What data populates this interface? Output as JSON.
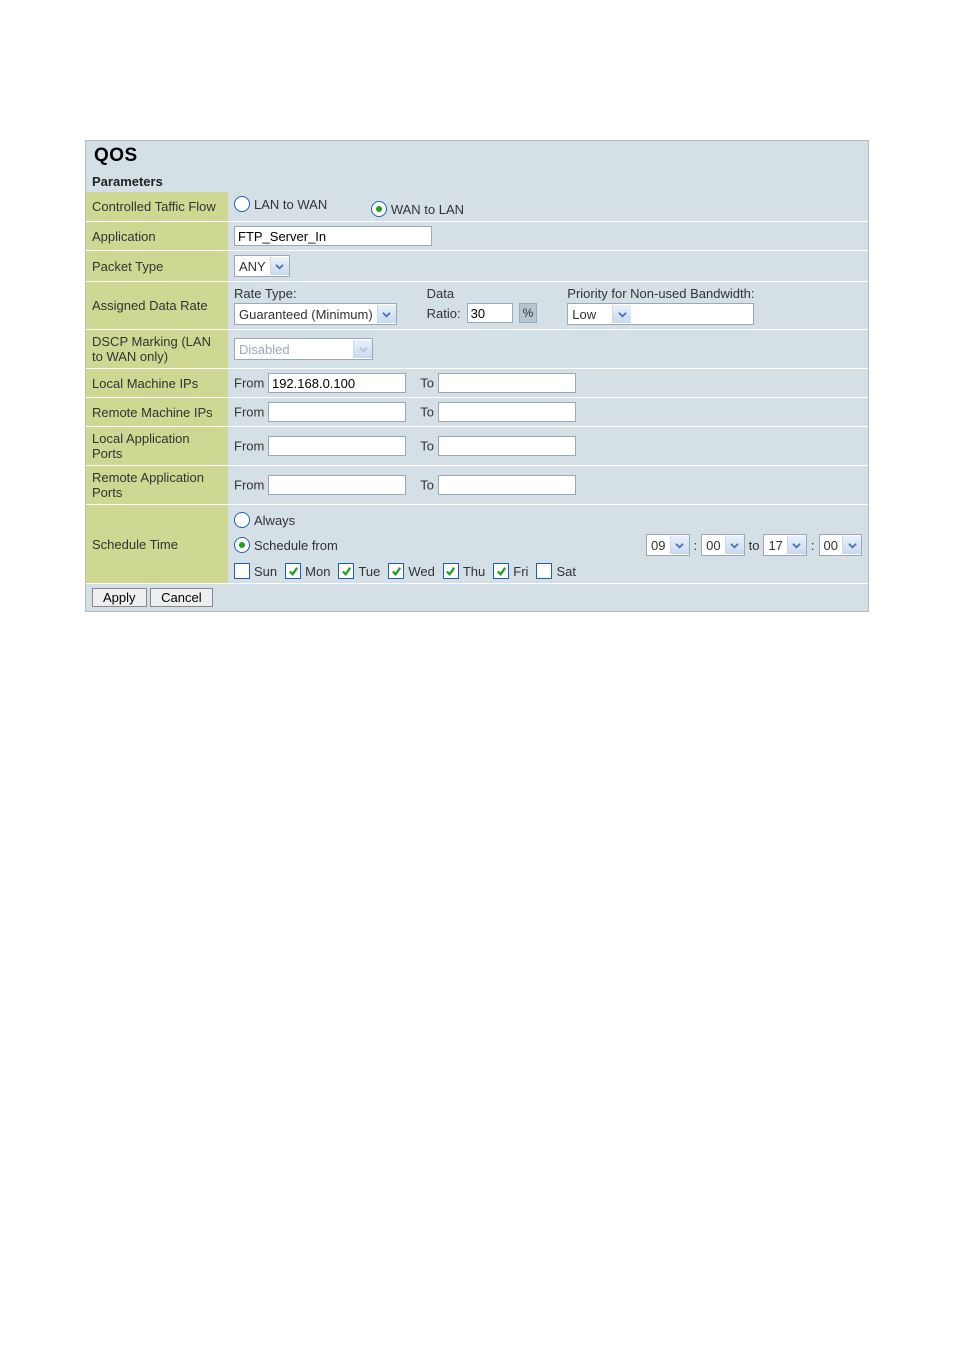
{
  "title": "QOS",
  "section": "Parameters",
  "rows": {
    "trafficFlow": {
      "label": "Controlled Taffic Flow",
      "opt1": "LAN to WAN",
      "opt2": "WAN to LAN",
      "selected": "wan_to_lan"
    },
    "application": {
      "label": "Application",
      "value": "FTP_Server_In"
    },
    "packetType": {
      "label": "Packet Type",
      "value": "ANY"
    },
    "assignedRate": {
      "label": "Assigned Data Rate",
      "rateTypeLabel": "Rate Type:",
      "rateTypeValue": "Guaranteed (Minimum)",
      "dataRatioLabel1": "Data",
      "dataRatioLabel2": "Ratio:",
      "dataRatioValue": "30",
      "dataRatioUnit": "%",
      "priorityLabel": "Priority for Non-used Bandwidth:",
      "priorityValue": "Low"
    },
    "dscp": {
      "label": "DSCP Marking (LAN to WAN only)",
      "value": "Disabled"
    },
    "localIPs": {
      "label": "Local Machine IPs",
      "fromLabel": "From",
      "fromValue": "192.168.0.100",
      "toLabel": "To",
      "toValue": ""
    },
    "remoteIPs": {
      "label": "Remote Machine IPs",
      "fromLabel": "From",
      "fromValue": "",
      "toLabel": "To",
      "toValue": ""
    },
    "localPorts": {
      "label": "Local Application Ports",
      "fromLabel": "From",
      "fromValue": "",
      "toLabel": "To",
      "toValue": ""
    },
    "remotePorts": {
      "label": "Remote Application Ports",
      "fromLabel": "From",
      "fromValue": "",
      "toLabel": "To",
      "toValue": ""
    },
    "schedule": {
      "label": "Schedule Time",
      "alwaysLabel": "Always",
      "fromLabel": "Schedule from",
      "toLabel": "to",
      "colon": ":",
      "fromHour": "09",
      "fromMin": "00",
      "toHour": "17",
      "toMin": "00",
      "days": {
        "sun": {
          "label": "Sun",
          "checked": false
        },
        "mon": {
          "label": "Mon",
          "checked": true
        },
        "tue": {
          "label": "Tue",
          "checked": true
        },
        "wed": {
          "label": "Wed",
          "checked": true
        },
        "thu": {
          "label": "Thu",
          "checked": true
        },
        "fri": {
          "label": "Fri",
          "checked": true
        },
        "sat": {
          "label": "Sat",
          "checked": false
        }
      }
    }
  },
  "buttons": {
    "apply": "Apply",
    "cancel": "Cancel"
  }
}
